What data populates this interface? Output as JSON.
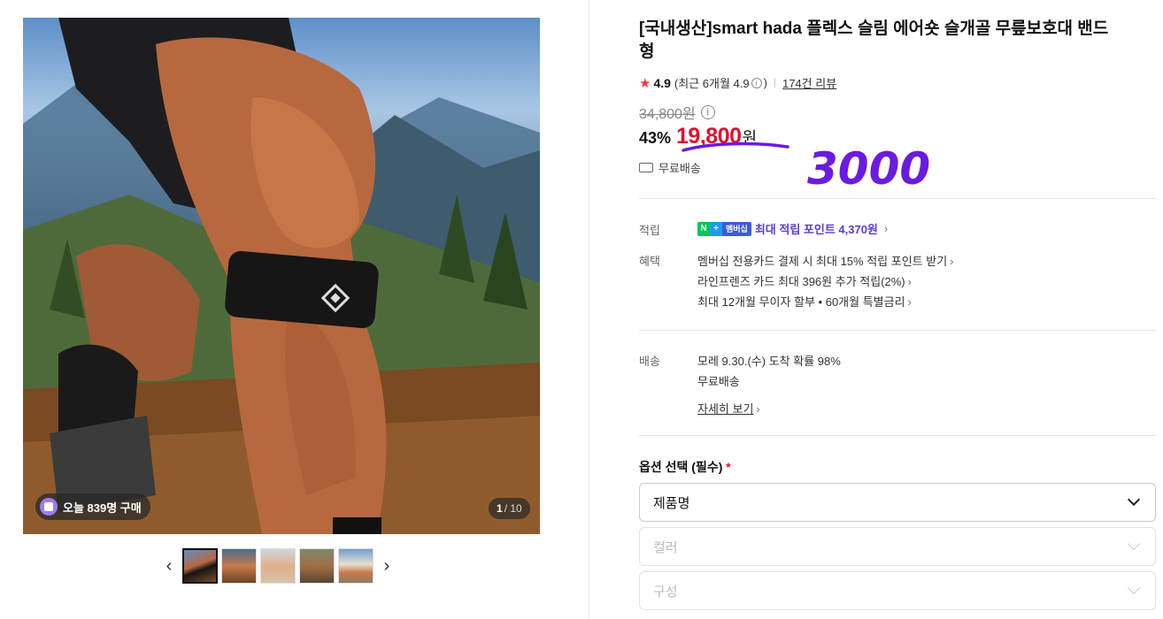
{
  "gallery": {
    "buy_badge": "오늘 839명 구매",
    "counter_current": "1",
    "counter_total": "/ 10",
    "thumbnail_count": 5
  },
  "product": {
    "title": "[국내생산]smart hada 플렉스 슬림 에어숏 슬개골 무릎보호대 밴드형",
    "rating": "4.9",
    "rating_recent": "(최근 6개월 4.9",
    "rating_recent_close": ")",
    "review_count": "174건 리뷰",
    "original_price": "34,800원",
    "discount": "43%",
    "price": "19,800",
    "price_unit": "원",
    "shipping_badge": "무료배송",
    "handwritten_note": "3000"
  },
  "benefits": {
    "points_label": "적립",
    "membership_badge": "멤버십",
    "points_text": "최대 적립 포인트 4,370원",
    "benefit_label": "혜택",
    "benefit_items": [
      "멤버십 전용카드 결제 시 최대 15% 적립 포인트 받기",
      "라인프렌즈 카드 최대 396원 추가 적립(2%)",
      "최대 12개월 무이자 할부 • 60개월 특별금리"
    ]
  },
  "delivery": {
    "label": "배송",
    "eta": "모레 9.30.(수) 도착 확률 98%",
    "fee": "무료배송",
    "detail_link": "자세히 보기"
  },
  "options": {
    "label": "옵션 선택 (필수)",
    "required_mark": "*",
    "selects": [
      "제품명",
      "컬러",
      "구성"
    ]
  },
  "colors": {
    "price_red": "#e00f2e",
    "point_purple": "#5a3cd6",
    "annotation_purple": "#6a1be0"
  }
}
